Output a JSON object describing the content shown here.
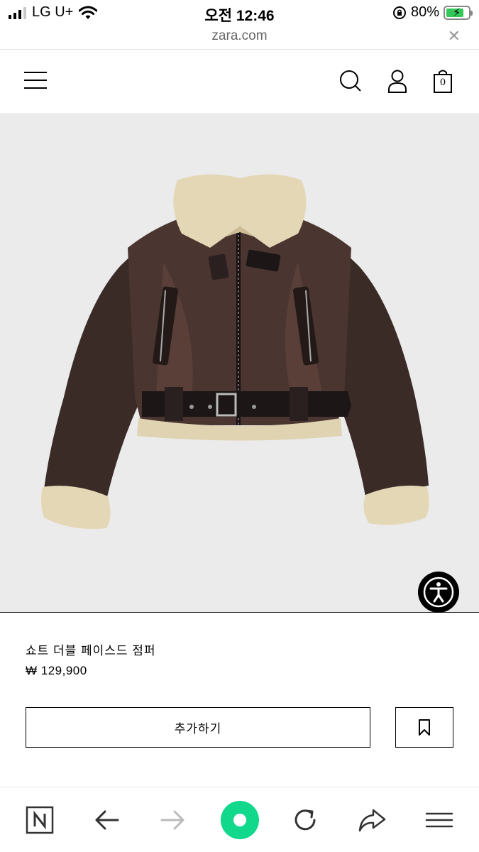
{
  "status_bar": {
    "carrier": "LG U+",
    "time": "오전 12:46",
    "battery": "80%",
    "battery_level": 0.8
  },
  "browser": {
    "url": "zara.com",
    "close_glyph": "✕"
  },
  "header": {
    "menu_icon": "hamburger-menu-icon",
    "search_icon": "search-icon",
    "account_icon": "user-icon",
    "bag_icon": "shopping-bag-icon",
    "bag_count": "0"
  },
  "product": {
    "name": "쇼트 더블 페이스드 점퍼",
    "price": "₩ 129,900",
    "add_button_label": "추가하기",
    "bookmark_icon": "bookmark-icon",
    "image_subject": "jacket-image",
    "image_bg": "#ebebeb"
  },
  "accessibility": {
    "icon": "accessibility-icon"
  },
  "toolbar": {
    "items": [
      "naver-n-icon",
      "back-arrow-icon",
      "forward-arrow-icon",
      "green-dot-icon",
      "reload-icon",
      "share-icon",
      "menu-lines-icon"
    ],
    "accent": "#11d88b"
  }
}
